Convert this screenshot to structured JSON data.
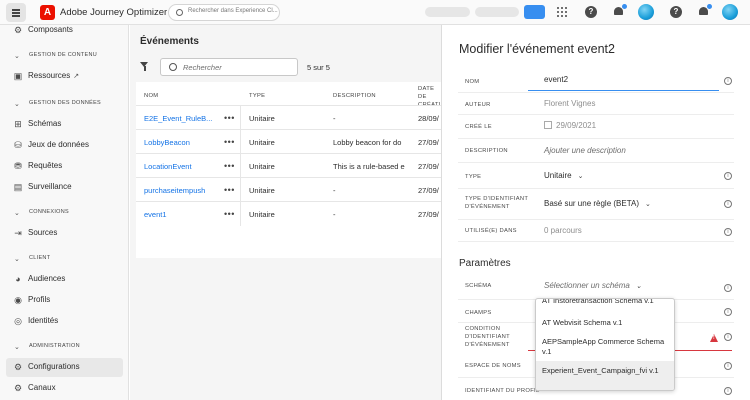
{
  "topbar": {
    "app_name": "Adobe Journey Optimizer",
    "logo_letter": "A",
    "search_placeholder": "Rechercher dans Experience Cl...",
    "help_label": "?"
  },
  "sidebar": {
    "items": [
      {
        "id": "composants",
        "label": "Composants",
        "icon": "components-icon"
      },
      {
        "id": "ressources",
        "label": "Ressources",
        "icon": "assets-icon"
      },
      {
        "id": "schemas",
        "label": "Schémas",
        "icon": "schema-icon"
      },
      {
        "id": "jeux",
        "label": "Jeux de données",
        "icon": "dataset-icon"
      },
      {
        "id": "requetes",
        "label": "Requêtes",
        "icon": "query-icon"
      },
      {
        "id": "surveillance",
        "label": "Surveillance",
        "icon": "monitor-icon"
      },
      {
        "id": "sources",
        "label": "Sources",
        "icon": "sources-icon"
      },
      {
        "id": "audiences",
        "label": "Audiences",
        "icon": "audiences-icon"
      },
      {
        "id": "profils",
        "label": "Profils",
        "icon": "profiles-icon"
      },
      {
        "id": "identites",
        "label": "Identités",
        "icon": "identities-icon"
      },
      {
        "id": "configurations",
        "label": "Configurations",
        "icon": "configurations-icon"
      },
      {
        "id": "canaux",
        "label": "Canaux",
        "icon": "channels-icon"
      }
    ],
    "sections": [
      {
        "label": "GESTION DE CONTENU"
      },
      {
        "label": "GESTION DES DONNÉES"
      },
      {
        "label": "CONNEXIONS"
      },
      {
        "label": "CLIENT"
      },
      {
        "label": "ADMINISTRATION"
      }
    ]
  },
  "main": {
    "title": "Événements",
    "search_placeholder": "Rechercher",
    "count": "5 sur 5",
    "columns": {
      "name": "NOM",
      "type": "TYPE",
      "description": "DESCRIPTION",
      "date": "DATE DE CRÉATI..."
    },
    "rows": [
      {
        "name": "E2E_Event_RuleB...",
        "type": "Unitaire",
        "description": "-",
        "date": "28/09/"
      },
      {
        "name": "LobbyBeacon",
        "type": "Unitaire",
        "description": "Lobby beacon for do",
        "date": "27/09/"
      },
      {
        "name": "LocationEvent",
        "type": "Unitaire",
        "description": "This is a rule-based e",
        "date": "27/09/"
      },
      {
        "name": "purchaseitempush",
        "type": "Unitaire",
        "description": "-",
        "date": "27/09/"
      },
      {
        "name": "event1",
        "type": "Unitaire",
        "description": "-",
        "date": "27/09/"
      }
    ],
    "more_label": "•••"
  },
  "panel": {
    "title": "Modifier l'événement event2",
    "fields": {
      "nom": {
        "label": "NOM",
        "value": "event2"
      },
      "auteur": {
        "label": "AUTEUR",
        "value": "Florent Vignes"
      },
      "cree": {
        "label": "CRÉÉ LE",
        "value": "29/09/2021"
      },
      "description": {
        "label": "DESCRIPTION",
        "placeholder": "Ajouter une description"
      },
      "type": {
        "label": "TYPE",
        "value": "Unitaire"
      },
      "type_id": {
        "label_1": "TYPE D'IDENTIFIANT",
        "label_2": "D'ÉVÉNEMENT",
        "value": "Basé sur une règle (BETA)"
      },
      "utilise": {
        "label": "UTILISÉ(E) DANS",
        "value": "0 parcours"
      }
    },
    "params_title": "Paramètres",
    "params": {
      "schema": {
        "label": "SCHÉMA",
        "placeholder": "Sélectionner un schéma"
      },
      "champs": {
        "label": "CHAMPS"
      },
      "condition": {
        "label_1": "CONDITION",
        "label_2": "D'IDENTIFIANT",
        "label_3": "D'ÉVÉNEMENT"
      },
      "espace": {
        "label": "ESPACE DE NOMS"
      },
      "identifiant": {
        "label": "IDENTIFIANT DU PROFIL"
      }
    },
    "dropdown_options": [
      {
        "label": "AT Instoretransaction Schema v.1"
      },
      {
        "label": "AT Webvisit Schema v.1"
      },
      {
        "label": "AEPSampleApp Commerce Schema v.1"
      },
      {
        "label": "Experient_Event_Campaign_fvi v.1",
        "selected": true
      }
    ]
  },
  "colors": {
    "accent": "#1473e6",
    "focus": "#378ef0",
    "error": "#d7373f",
    "brand": "#eb1000"
  }
}
